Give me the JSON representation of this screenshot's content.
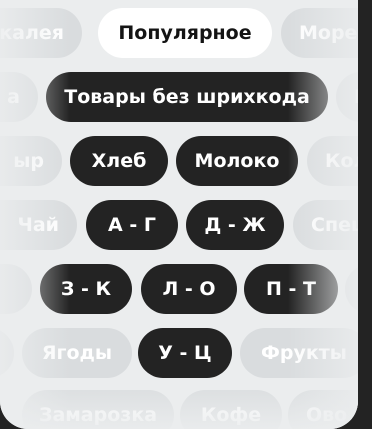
{
  "categories": {
    "row1": [
      "калея",
      "Популярное",
      "Море"
    ],
    "row2": [
      "а",
      "Товары без шрихкода",
      "М"
    ],
    "row3": [
      "ыр",
      "Хлеб",
      "Молоко",
      "Кол"
    ],
    "row4": [
      "Чай",
      "А - Г",
      "Д - Ж",
      "Спец"
    ],
    "row5": [
      "",
      "З - К",
      "Л - О",
      "П - Т",
      "К"
    ],
    "row6": [
      "",
      "Ягоды",
      "У - Ц",
      "Фрукты"
    ],
    "row7": [
      "Замарозка",
      "Кофе",
      "Ово"
    ]
  },
  "colors": {
    "background": "#232323",
    "panel": "#ebedee",
    "active_pill": "#232323",
    "selected_pill": "#ffffff",
    "inactive_pill": "#d9dcde"
  }
}
